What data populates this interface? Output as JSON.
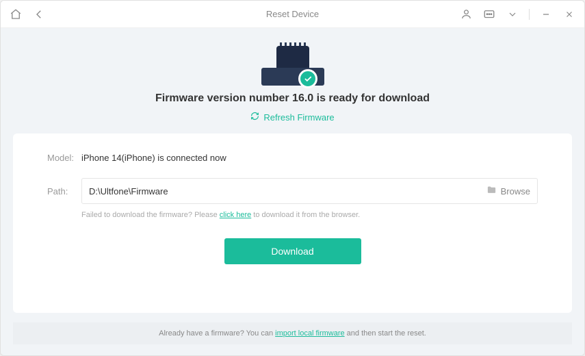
{
  "titlebar": {
    "title": "Reset Device"
  },
  "hero": {
    "title": "Firmware version number 16.0 is ready for download",
    "refresh_label": "Refresh Firmware"
  },
  "model": {
    "label": "Model:",
    "value": "iPhone 14(iPhone) is connected now"
  },
  "path": {
    "label": "Path:",
    "value": "D:\\Ultfone\\Firmware",
    "browse_label": "Browse"
  },
  "help": {
    "prefix": "Failed to download the firmware? Please ",
    "link": "click here",
    "suffix": " to download it from the browser."
  },
  "download_label": "Download",
  "footer": {
    "prefix": "Already have a firmware? You can ",
    "link": "import local firmware",
    "suffix": " and then start the reset."
  }
}
